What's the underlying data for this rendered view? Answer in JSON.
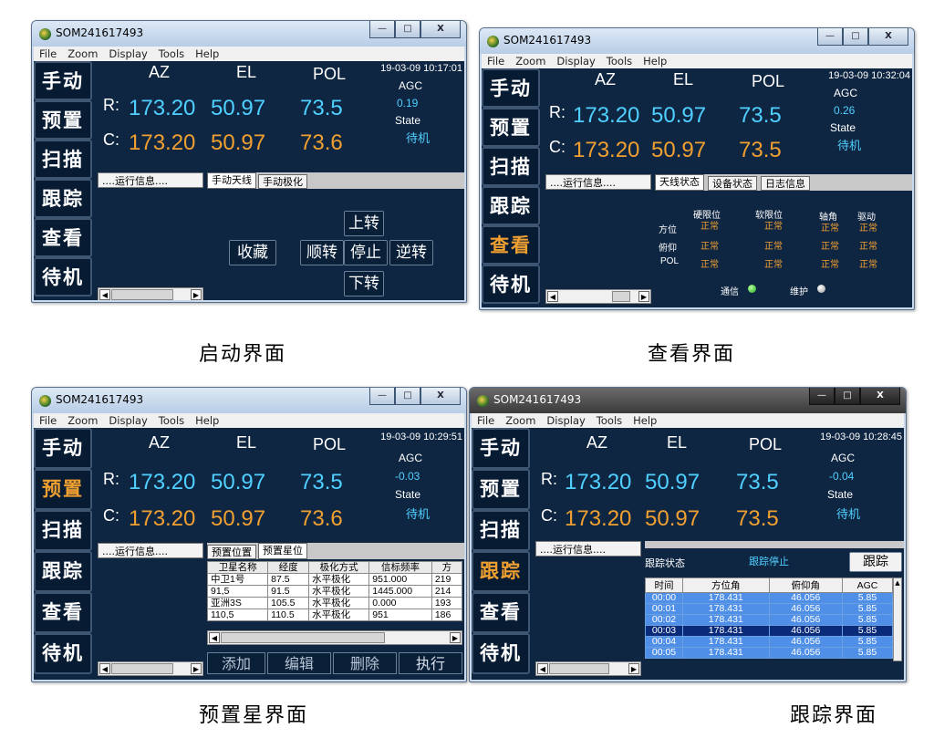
{
  "title": "SOM241617493",
  "menu": [
    "File",
    "Zoom",
    "Display",
    "Tools",
    "Help"
  ],
  "sidebar": [
    "手动",
    "预置",
    "扫描",
    "跟踪",
    "查看",
    "待机"
  ],
  "headers": {
    "az": "AZ",
    "el": "EL",
    "pol": "POL",
    "r": "R:",
    "c": "C:",
    "agc": "AGC",
    "state": "State"
  },
  "runinfo": "....运行信息....",
  "window_buttons": {
    "min": "—",
    "max": "□",
    "close": "X"
  },
  "panels": [
    {
      "caption": "启动界面",
      "timestamp": "19-03-09 10:17:01",
      "r": {
        "az": "173.20",
        "el": "50.97",
        "pol": "73.5"
      },
      "c": {
        "az": "173.20",
        "el": "50.97",
        "pol": "73.6"
      },
      "agc": "0.19",
      "state": "待机",
      "tabs": [
        "手动天线",
        "手动极化"
      ],
      "controls": {
        "up": "上转",
        "fav": "收藏",
        "cw": "顺转",
        "stop": "停止",
        "ccw": "逆转",
        "down": "下转"
      }
    },
    {
      "caption": "查看界面",
      "timestamp": "19-03-09 10:32:04",
      "r": {
        "az": "173.20",
        "el": "50.97",
        "pol": "73.5"
      },
      "c": {
        "az": "173.20",
        "el": "50.97",
        "pol": "73.5"
      },
      "agc": "0.26",
      "state": "待机",
      "tabs": [
        "天线状态",
        "设备状态",
        "日志信息"
      ],
      "status": {
        "cols": [
          "硬限位",
          "软限位",
          "轴角",
          "驱动"
        ],
        "rows": [
          {
            "name": "方位",
            "vals": [
              "正常",
              "正常",
              "正常",
              "正常"
            ]
          },
          {
            "name": "俯仰",
            "vals": [
              "正常",
              "正常",
              "正常",
              "正常"
            ]
          },
          {
            "name": "POL",
            "vals": [
              "正常",
              "正常",
              "正常",
              "正常"
            ]
          }
        ],
        "comm": "通信",
        "maint": "维护"
      }
    },
    {
      "caption": "预置星界面",
      "timestamp": "19-03-09 10:29:51",
      "r": {
        "az": "173.20",
        "el": "50.97",
        "pol": "73.5"
      },
      "c": {
        "az": "173.20",
        "el": "50.97",
        "pol": "73.6"
      },
      "agc": "-0.03",
      "state": "待机",
      "tabs": [
        "预置位置",
        "预置星位"
      ],
      "table": {
        "headers": [
          "卫星名称",
          "经度",
          "极化方式",
          "信标频率",
          "方"
        ],
        "rows": [
          [
            "中卫1号",
            "87.5",
            "水平极化",
            "951.000",
            "219"
          ],
          [
            "91,5",
            "91.5",
            "水平极化",
            "1445.000",
            "214"
          ],
          [
            "亚洲3S",
            "105.5",
            "水平极化",
            "0.000",
            "193"
          ],
          [
            "110,5",
            "110.5",
            "水平极化",
            "951",
            "186"
          ]
        ]
      },
      "buttons": [
        "添加",
        "编辑",
        "删除",
        "执行"
      ]
    },
    {
      "caption": "跟踪界面",
      "timestamp": "19-03-09 10:28:45",
      "r": {
        "az": "173.20",
        "el": "50.97",
        "pol": "73.5"
      },
      "c": {
        "az": "173.20",
        "el": "50.97",
        "pol": "73.5"
      },
      "agc": "-0.04",
      "state": "待机",
      "track": {
        "label": "跟踪状态",
        "status": "跟踪停止",
        "button": "跟踪",
        "headers": [
          "时间",
          "方位角",
          "俯仰角",
          "AGC"
        ],
        "rows": [
          [
            "00:00",
            "178.431",
            "46.056",
            "5.85"
          ],
          [
            "00:01",
            "178.431",
            "46.056",
            "5.85"
          ],
          [
            "00:02",
            "178.431",
            "46.056",
            "5.85"
          ],
          [
            "00:03",
            "178.431",
            "46.056",
            "5.85"
          ],
          [
            "00:04",
            "178.431",
            "46.056",
            "5.85"
          ],
          [
            "00:05",
            "178.431",
            "46.056",
            "5.85"
          ]
        ]
      }
    }
  ],
  "colors": {
    "bg": "#0f2643",
    "cyan": "#4fd0ff",
    "orange": "#f0a030",
    "green_led": "#3cd23c",
    "gray_led": "#c8c8c8"
  }
}
